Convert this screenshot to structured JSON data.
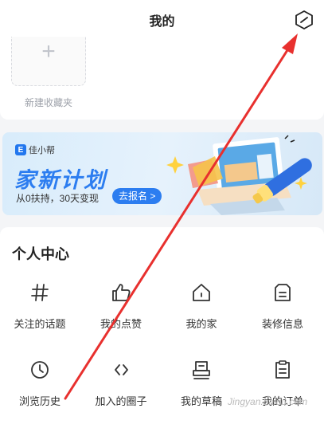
{
  "header": {
    "title": "我的",
    "settings_icon": "settings-hexagon-icon"
  },
  "favorites": {
    "new_label": "新建收藏夹",
    "add_icon": "plus-icon"
  },
  "banner": {
    "brand": "佳小帮",
    "brand_logo": "E",
    "headline": "家新计划",
    "subtitle": "从0扶持，30天变现",
    "cta": "去报名 >"
  },
  "personal": {
    "title": "个人中心",
    "items": [
      {
        "label": "关注的话题",
        "icon": "hashtag-icon"
      },
      {
        "label": "我的点赞",
        "icon": "thumbs-up-icon"
      },
      {
        "label": "我的家",
        "icon": "home-icon"
      },
      {
        "label": "装修信息",
        "icon": "document-icon"
      },
      {
        "label": "浏览历史",
        "icon": "clock-icon"
      },
      {
        "label": "加入的圈子",
        "icon": "code-brackets-icon"
      },
      {
        "label": "我的草稿",
        "icon": "draft-stamp-icon"
      },
      {
        "label": "我的订单",
        "icon": "order-list-icon"
      }
    ]
  },
  "annotation": {
    "arrow_color": "#e8302e"
  },
  "watermark": "Jingyan.baidu.com"
}
